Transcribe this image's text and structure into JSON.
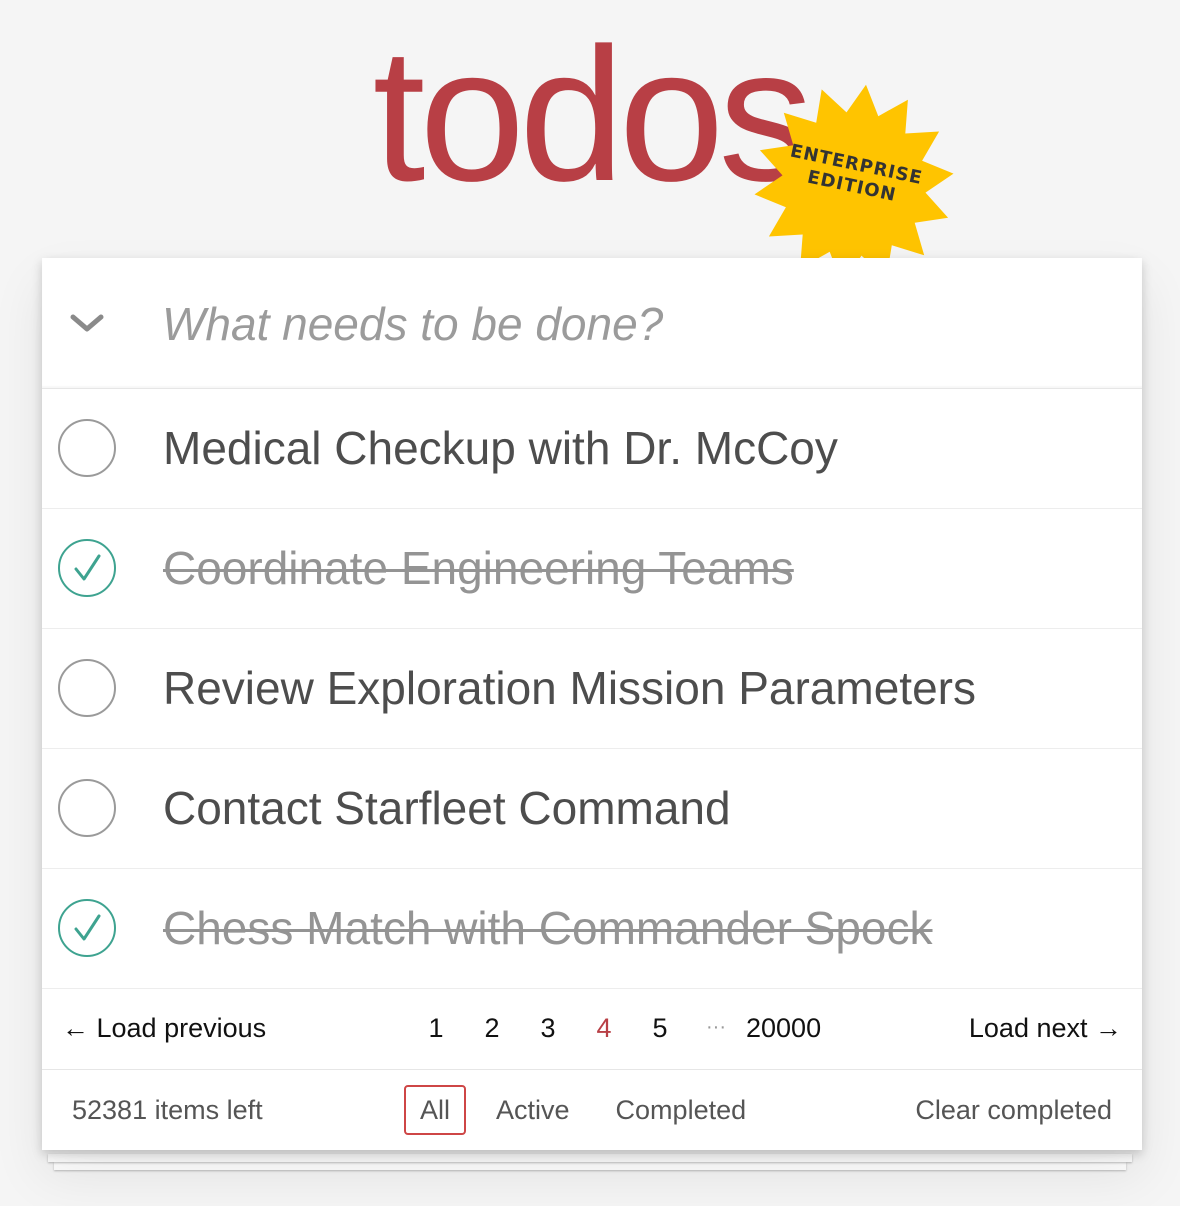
{
  "app": {
    "title": "todos",
    "badge_line1": "ENTERPRISE",
    "badge_line2": "EDITION"
  },
  "colors": {
    "title": "#b83f45",
    "badge": "#ffc400",
    "check": "#3ea390",
    "selected_filter_border": "#ce4646"
  },
  "header": {
    "toggle_icon": "chevron-down-icon",
    "new_todo_placeholder": "What needs to be done?"
  },
  "todos": [
    {
      "label": "Medical Checkup with Dr. McCoy",
      "completed": false
    },
    {
      "label": "Coordinate Engineering Teams",
      "completed": true
    },
    {
      "label": "Review Exploration Mission Parameters",
      "completed": false
    },
    {
      "label": "Contact Starfleet Command",
      "completed": false
    },
    {
      "label": "Chess Match with Commander Spock",
      "completed": true
    }
  ],
  "pager": {
    "prev_label": "← Load previous",
    "next_label": "Load next →",
    "pages": [
      "1",
      "2",
      "3",
      "4",
      "5"
    ],
    "current_page": "4",
    "ellipsis": "···",
    "last_page": "20000"
  },
  "footer": {
    "items_left": "52381 items left",
    "filters": [
      "All",
      "Active",
      "Completed"
    ],
    "selected_filter": "All",
    "clear_completed": "Clear completed"
  }
}
